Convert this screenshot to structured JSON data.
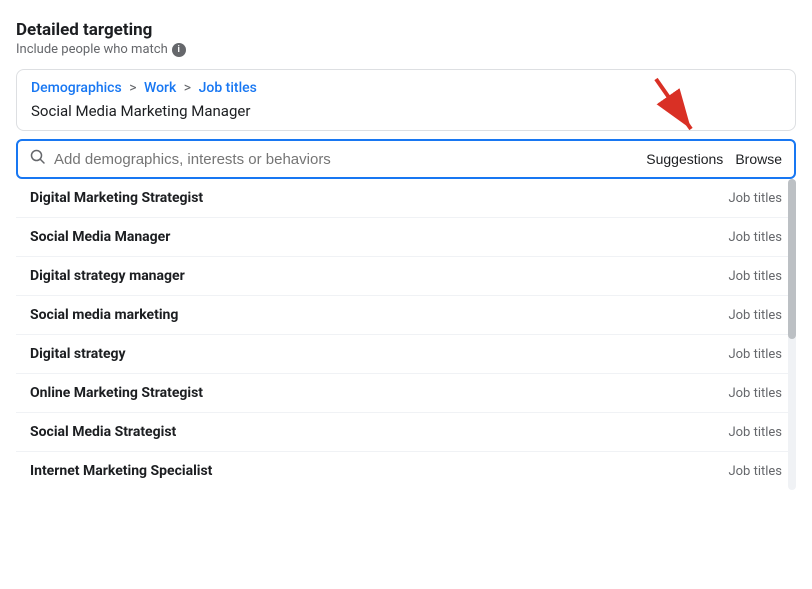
{
  "header": {
    "title": "Detailed targeting",
    "subtitle": "Include people who match"
  },
  "breadcrumb": {
    "part1": "Demographics",
    "separator1": ">",
    "part2": "Work",
    "separator2": ">",
    "part3": "Job titles"
  },
  "selected_tag": "Social Media Marketing Manager",
  "search": {
    "placeholder": "Add demographics, interests or behaviors",
    "suggestions_label": "Suggestions",
    "browse_label": "Browse"
  },
  "results": [
    {
      "name": "Digital Marketing Strategist",
      "category": "Job titles"
    },
    {
      "name": "Social Media Manager",
      "category": "Job titles"
    },
    {
      "name": "Digital strategy manager",
      "category": "Job titles"
    },
    {
      "name": "Social media marketing",
      "category": "Job titles"
    },
    {
      "name": "Digital strategy",
      "category": "Job titles"
    },
    {
      "name": "Online Marketing Strategist",
      "category": "Job titles"
    },
    {
      "name": "Social Media Strategist",
      "category": "Job titles"
    },
    {
      "name": "Internet Marketing Specialist",
      "category": "Job titles"
    }
  ]
}
